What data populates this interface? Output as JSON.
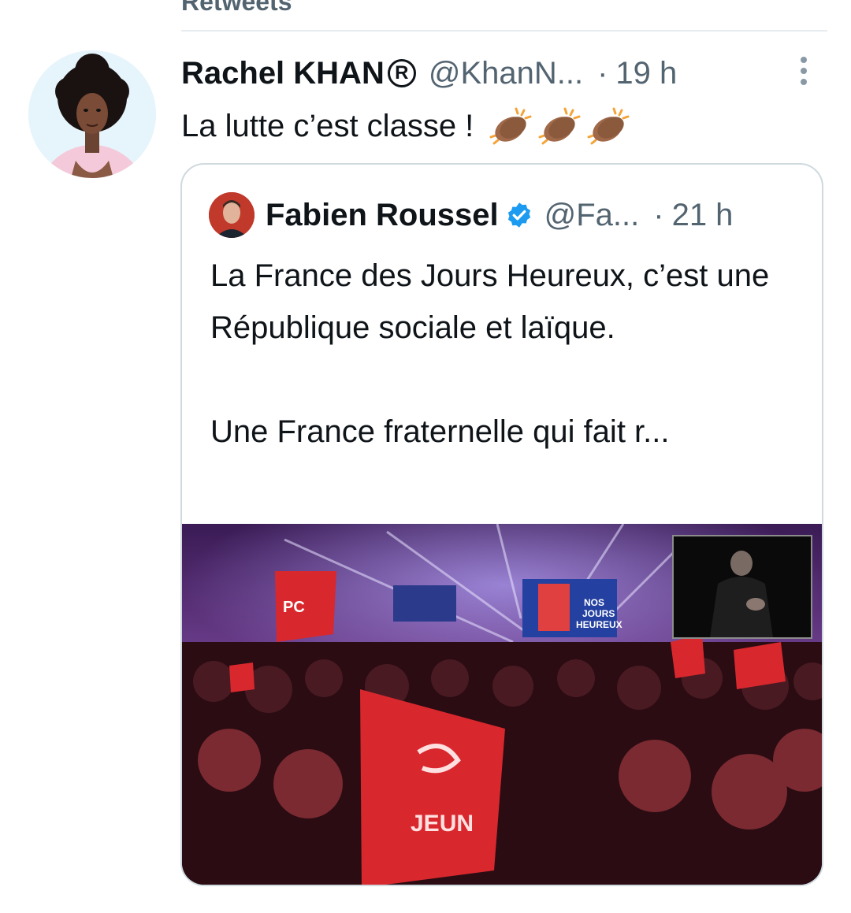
{
  "section_header": "Retweets",
  "tweet": {
    "author_name": "Rachel KHAN",
    "registered_mark": "R",
    "handle": "@KhanN...",
    "separator": "·",
    "time": "19 h",
    "text": "La lutte c’est classe !",
    "emoji_icons": [
      "clapping-hands-icon",
      "clapping-hands-icon",
      "clapping-hands-icon"
    ],
    "clap_color": "#a0694a"
  },
  "quote": {
    "author_name": "Fabien Roussel",
    "handle": "@Fa...",
    "separator": "·",
    "time": "21 h",
    "paragraphs": [
      "La France des Jours Heureux, c’est une République sociale et laïque.",
      "Une France fraternelle qui fait r..."
    ],
    "verified_color": "#1d9bf0",
    "media": {
      "type": "video",
      "flag_text_left": "PC",
      "flag_text_bottom": "JEUN",
      "screen_text": "NOS JOURS HEUREUX"
    }
  },
  "colors": {
    "primary_text": "#0f1419",
    "secondary_text": "#536471",
    "border": "#cfd9de"
  }
}
